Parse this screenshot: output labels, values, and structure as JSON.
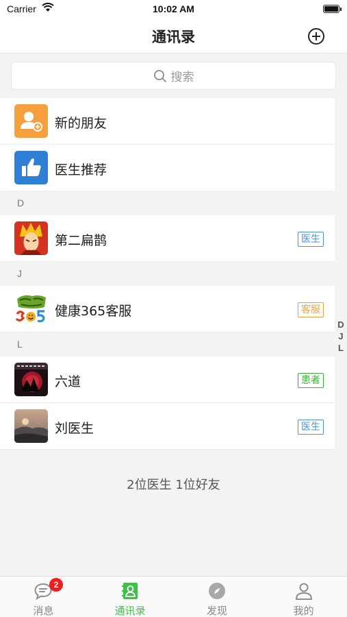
{
  "status_bar": {
    "carrier": "Carrier",
    "time": "10:02 AM"
  },
  "nav": {
    "title": "通讯录"
  },
  "search": {
    "placeholder": "搜索"
  },
  "actions": [
    {
      "label": "新的朋友",
      "icon": "add-friend-icon",
      "color": "#f5a03c"
    },
    {
      "label": "医生推荐",
      "icon": "thumbs-up-icon",
      "color": "#2f7fd6"
    }
  ],
  "sections": [
    {
      "letter": "D",
      "contacts": [
        {
          "name": "第二扁鹊",
          "tag": "医生",
          "avatar": "anime-character"
        }
      ]
    },
    {
      "letter": "J",
      "contacts": [
        {
          "name": "健康365客服",
          "tag": "客服",
          "avatar": "health365-logo"
        }
      ]
    },
    {
      "letter": "L",
      "contacts": [
        {
          "name": "六道",
          "tag": "患者",
          "avatar": "dark-red-moon"
        },
        {
          "name": "刘医生",
          "tag": "医生",
          "avatar": "landscape-photo"
        }
      ]
    }
  ],
  "index_letters": [
    "D",
    "J",
    "L"
  ],
  "footer": {
    "count_text": "2位医生 1位好友"
  },
  "tabs": [
    {
      "label": "消息",
      "icon": "chat-icon",
      "badge": "2"
    },
    {
      "label": "通讯录",
      "icon": "contacts-icon"
    },
    {
      "label": "发现",
      "icon": "compass-icon"
    },
    {
      "label": "我的",
      "icon": "profile-icon"
    }
  ],
  "colors": {
    "accent_green": "#3fbf48",
    "doctor_tag": "#4a90d9",
    "service_tag": "#f0a23a",
    "patient_tag": "#3db03a",
    "badge_red": "#f21d1d"
  }
}
